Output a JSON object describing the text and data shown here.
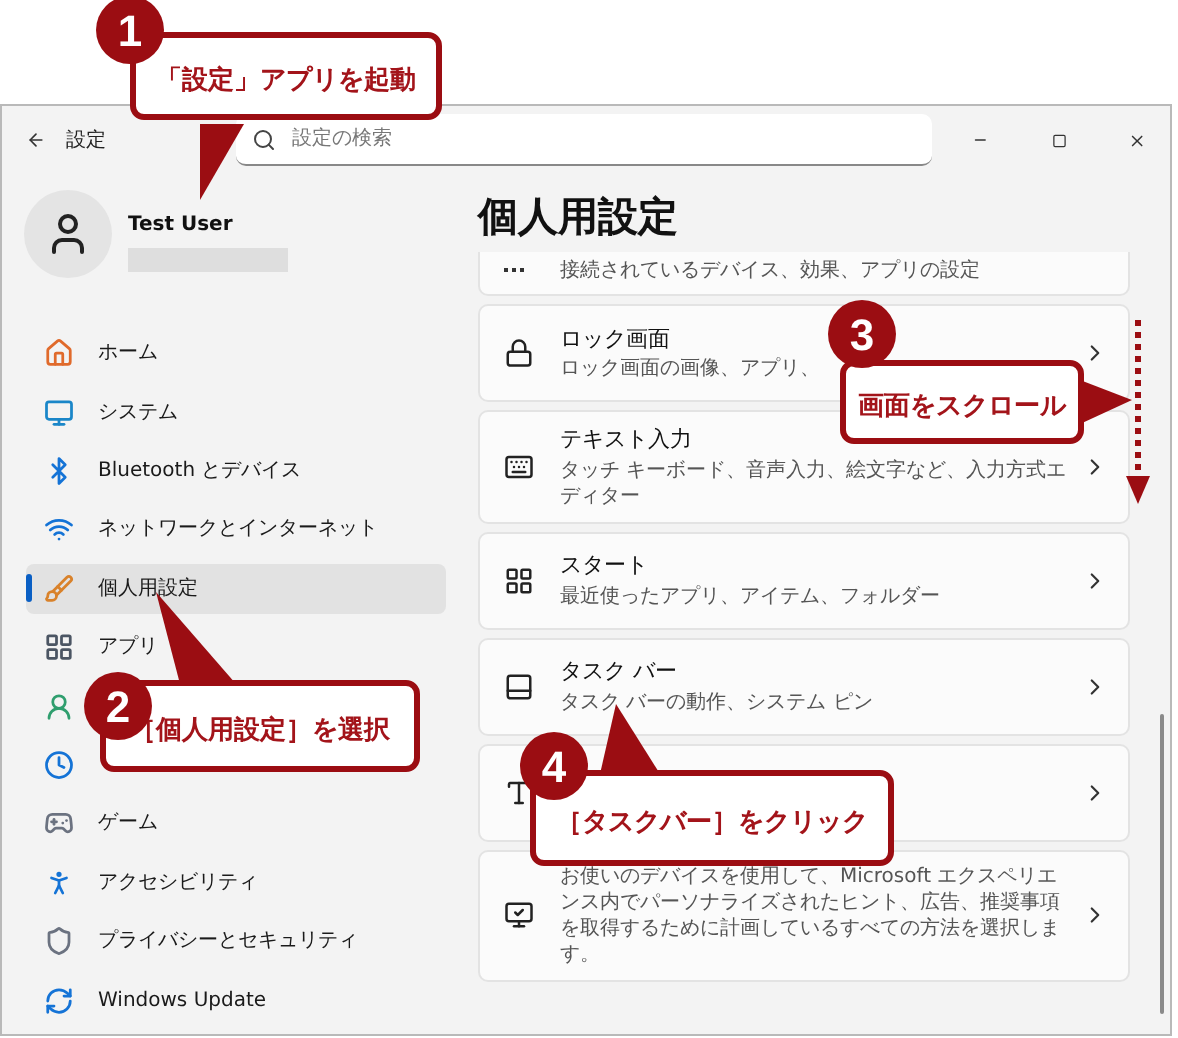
{
  "window": {
    "title": "設定",
    "search": {
      "placeholder": "設定の検索"
    }
  },
  "profile": {
    "name": "Test User"
  },
  "sidebar": {
    "items": [
      {
        "kind": "link",
        "label": "ホーム",
        "selected": false
      },
      {
        "kind": "link",
        "label": "システム",
        "selected": false
      },
      {
        "kind": "link",
        "label": "Bluetooth とデバイス",
        "selected": false
      },
      {
        "kind": "link",
        "label": "ネットワークとインターネット",
        "selected": false
      },
      {
        "kind": "link",
        "label": "個人用設定",
        "selected": true
      },
      {
        "kind": "link",
        "label": "アプリ",
        "selected": false
      },
      {
        "kind": "covered"
      },
      {
        "kind": "covered"
      },
      {
        "kind": "link",
        "label": "ゲーム",
        "selected": false
      },
      {
        "kind": "link",
        "label": "アクセシビリティ",
        "selected": false
      },
      {
        "kind": "link",
        "label": "プライバシーとセキュリティ",
        "selected": false
      },
      {
        "kind": "link",
        "label": "Windows Update",
        "selected": false
      }
    ]
  },
  "page": {
    "heading": "個人用設定",
    "cards": [
      {
        "kind": "partial",
        "description": "接続されているデバイス、効果、アプリの設定"
      },
      {
        "kind": "full",
        "title": "ロック画面",
        "description": "ロック画面の画像、アプリ、"
      },
      {
        "kind": "full",
        "title": "テキスト入力",
        "description": "タッチ キーボード、音声入力、絵文字など、入力方式エディター"
      },
      {
        "kind": "full",
        "title": "スタート",
        "description": "最近使ったアプリ、アイテム、フォルダー"
      },
      {
        "kind": "full",
        "title": "タスク バー",
        "description": "タスク バーの動作、システム ピン"
      },
      {
        "kind": "full"
      },
      {
        "kind": "full",
        "description": "お使いのデバイスを使用して、Microsoft エクスペリエンス内でパーソナライズされたヒント、広告、推奨事項を取得するために計画しているすべての方法を選択します。"
      }
    ]
  },
  "annotations": [
    {
      "number": "1",
      "text": "「設定」アプリを起動"
    },
    {
      "number": "2",
      "text": "［個人用設定］を選択"
    },
    {
      "number": "3",
      "text": "画面をスクロール"
    },
    {
      "number": "4",
      "text": "［タスクバー］をクリック"
    }
  ]
}
